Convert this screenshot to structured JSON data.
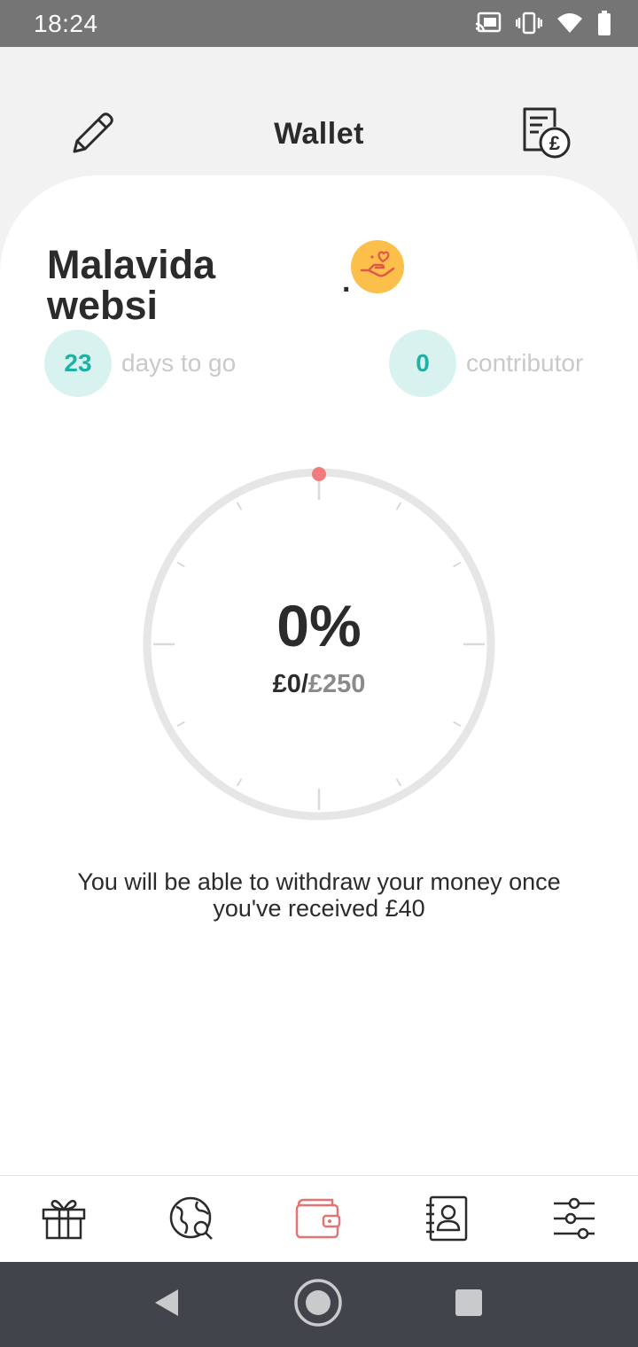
{
  "status_bar": {
    "time": "18:24",
    "icons": [
      "cast-icon",
      "vibrate-icon",
      "wifi-icon",
      "battery-icon"
    ]
  },
  "header": {
    "title": "Wallet",
    "left_icon": "pencil-icon",
    "right_icon": "invoice-pound-icon"
  },
  "wallet": {
    "name": "Malavida websi",
    "name_suffix": ".",
    "badge_icon": "hand-heart-icon",
    "days_count": "23",
    "days_label": "days to go",
    "contributor_count": "0",
    "contributor_label": "contributor",
    "percent": "0%",
    "progress": 0,
    "amount_raised": "£0",
    "amount_separator": "/",
    "amount_goal": "£250",
    "withdraw_note": "You will be able to withdraw your money once you've received £40"
  },
  "bottom_nav": {
    "items": [
      {
        "icon": "gift-icon",
        "active": false
      },
      {
        "icon": "globe-search-icon",
        "active": false
      },
      {
        "icon": "wallet-icon",
        "active": true
      },
      {
        "icon": "contacts-icon",
        "active": false
      },
      {
        "icon": "sliders-icon",
        "active": false
      }
    ]
  },
  "colors": {
    "accent_teal": "#1fb1a3",
    "teal_bg": "#d8f2ef",
    "active_nav": "#e57373",
    "gauge_marker": "#f07b7b",
    "badge_yellow": "#fbbf4a",
    "status_bar": "#757575",
    "system_nav": "#41454b"
  }
}
